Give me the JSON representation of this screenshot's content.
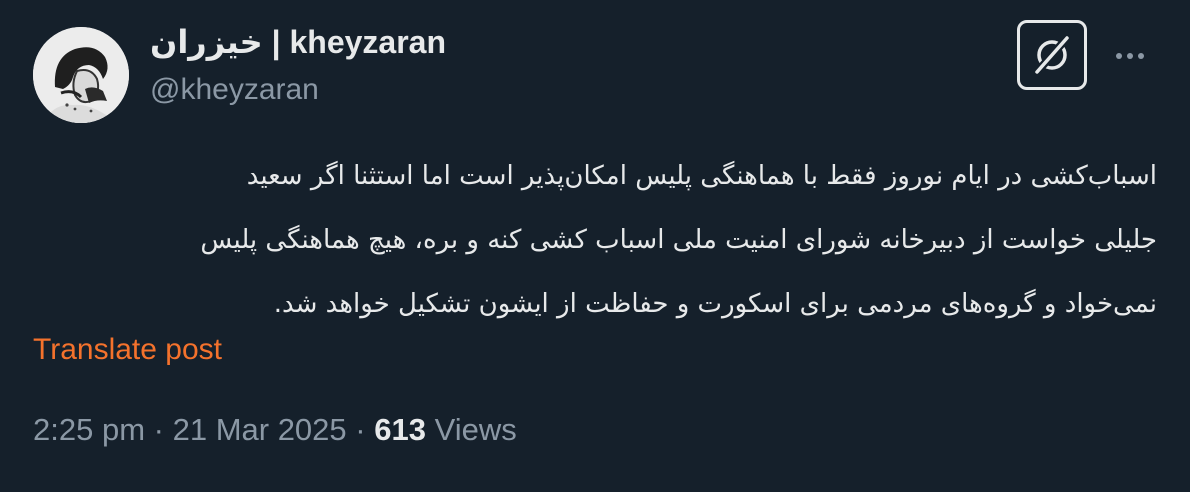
{
  "author": {
    "display_name": "خیزران | kheyzaran",
    "handle": "@kheyzaran",
    "avatar_icon": "avatar-illustration"
  },
  "actions": {
    "grok_icon": "grok-icon",
    "more_icon": "more-horizontal-icon"
  },
  "tweet": {
    "lines": [
      "اسباب‌کشی در ایام نوروز فقط با هماهنگی پلیس امکان‌پذیر است اما استثنا اگر سعید",
      "جلیلی خواست از دبیرخانه شورای امنیت ملی اسباب کشی کنه و بره، هیچ هماهنگی پلیس",
      "نمی‌خواد و گروه‌های مردمی برای اسکورت و حفاظت از ایشون تشکیل خواهد شد."
    ],
    "translate_label": "Translate post"
  },
  "meta": {
    "time": "2:25 pm",
    "separator": "·",
    "date": "21 Mar 2025",
    "views_count": "613",
    "views_label": "Views"
  },
  "colors": {
    "background": "#15202b",
    "text": "#e7e9ea",
    "secondary": "#8b98a5",
    "link": "#f4722c"
  }
}
